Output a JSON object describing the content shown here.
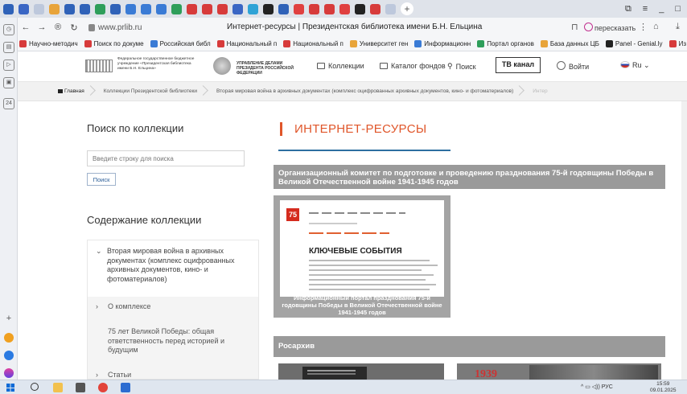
{
  "browser": {
    "tab_colors": [
      "#2f62b8",
      "#3a66c4",
      "#bdc8dc",
      "#e8a43a",
      "#2f62b8",
      "#2f62b8",
      "#2e9e5a",
      "#2f62b8",
      "#3a7bd5",
      "#3a7bd5",
      "#3a7bd5",
      "#2e9e5a",
      "#d73b3b",
      "#d73b3b",
      "#d73b3b",
      "#3a66c4",
      "#2fa3d6",
      "#222222",
      "#2f62b8",
      "#e04040",
      "#d73b3b",
      "#d73b3b",
      "#e04040",
      "#222222",
      "#d73b3b",
      "#bdc8dc"
    ],
    "new_tab_label": "+",
    "window_controls": [
      "⧉",
      "≡",
      "_",
      "□"
    ],
    "url": "www.prlib.ru",
    "page_title": "Интернет-ресурсы | Президентская библиотека имени Б.Н. Ельцина",
    "retell_label": "пересказать",
    "bookmarks": [
      {
        "label": "Научно-методич",
        "color": "#d73b3b"
      },
      {
        "label": "Поиск по докуме",
        "color": "#d73b3b"
      },
      {
        "label": "Российская библ",
        "color": "#3a7bd5"
      },
      {
        "label": "Национальный п",
        "color": "#d73b3b"
      },
      {
        "label": "Национальный п",
        "color": "#d73b3b"
      },
      {
        "label": "Университет ген",
        "color": "#e8a43a"
      },
      {
        "label": "Информационн",
        "color": "#3a7bd5"
      },
      {
        "label": "Портал органов",
        "color": "#2e9e5a"
      },
      {
        "label": "База данных ЦБ",
        "color": "#e8a43a"
      },
      {
        "label": "Panel - Genial.ly",
        "color": "#222222"
      },
      {
        "label": "Из",
        "color": "#d73b3b"
      }
    ]
  },
  "site": {
    "logo_text": "Федеральное государственное бюджетное учреждение «Президентская библиотека имени Б.Н. Ельцина»",
    "admin_text": "УПРАВЛЕНИЕ ДЕЛАМИ ПРЕЗИДЕНТА РОССИЙСКОЙ ФЕДЕРАЦИИ",
    "nav_collections": "Коллекции",
    "nav_catalog": "Каталог фондов",
    "nav_search": "Поиск",
    "tv_button": "ТВ канал",
    "login": "Войти",
    "lang": "Ru"
  },
  "breadcrumbs": [
    "Главная",
    "Коллекции Президентской библиотеки",
    "Вторая мировая война в архивных документах (комплекс оцифрованных архивных документов, кино- и фотоматериалов)",
    "Интер"
  ],
  "sidebar": {
    "search_title": "Поиск по коллекции",
    "search_placeholder": "Введите строку для поиска",
    "search_button": "Поиск",
    "contents_title": "Содержание коллекции",
    "tree": [
      {
        "chev": "⌄",
        "label": "Вторая мировая война в архивных документах (комплекс оцифрованных архивных документов, кино- и фотоматериалов)"
      },
      {
        "chev": "›",
        "label": "О комплексе"
      },
      {
        "chev": "",
        "label": "75 лет Великой Победы: общая ответственность перед историей и будущим"
      },
      {
        "chev": "›",
        "label": "Статьи"
      }
    ]
  },
  "main": {
    "title": "ИНТЕРНЕТ-РЕСУРСЫ",
    "banner1": "Организационный комитет по подготовке и проведению празднования 75-й годовщины Победы в Великой Отечественной войне 1941-1945 годов",
    "thumb_logo": "75",
    "thumb_heading": "КЛЮЧЕВЫЕ СОБЫТИЯ",
    "thumb_caption": "Информационный портал празднования 75-й годовщины Победы в Великой Отечественной войне 1941-1945 годов",
    "banner2": "Росархив",
    "ros_year": "1939"
  },
  "taskbar": {
    "lang": "РУС",
    "time": "15:59",
    "date": "09.01.2025"
  }
}
